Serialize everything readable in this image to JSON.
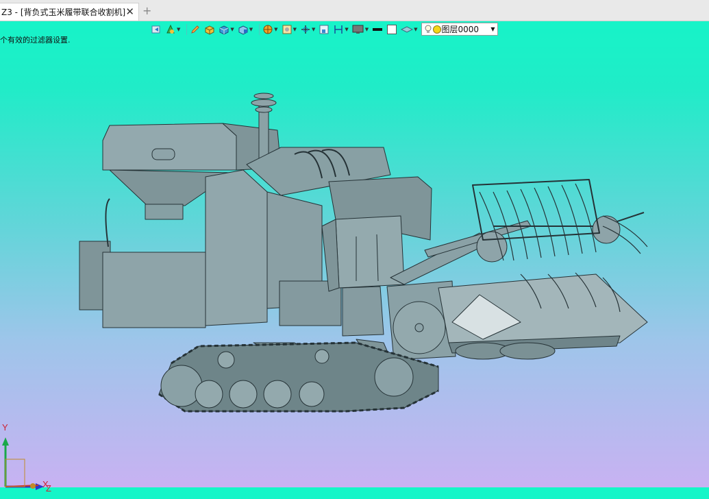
{
  "tab": {
    "title": "Z3 - [背负式玉米履带联合收割机]",
    "close": "✕",
    "add": "+"
  },
  "status": {
    "message": "个有效的过滤器设置."
  },
  "toolbar": {
    "layer": {
      "name": "图层0000",
      "arrow": "▼"
    },
    "tools": [
      "view-restore-icon",
      "render-mode-icon",
      "pencil-icon",
      "solid-box-icon",
      "shaded-cube-icon",
      "wire-cube-icon",
      "sphere-icon",
      "frame-icon",
      "axis-icon",
      "region-icon",
      "dimension-icon",
      "display-icon",
      "color-black-icon",
      "color-white-icon",
      "layer-stack-icon"
    ]
  },
  "axes": {
    "y": "Y",
    "x": "X",
    "z": "Z"
  },
  "colors": {
    "model_fill": "#8da3a8",
    "model_stroke": "#253236",
    "bg_top": "#14f6c8",
    "bg_bottom": "#c8b2f2"
  }
}
